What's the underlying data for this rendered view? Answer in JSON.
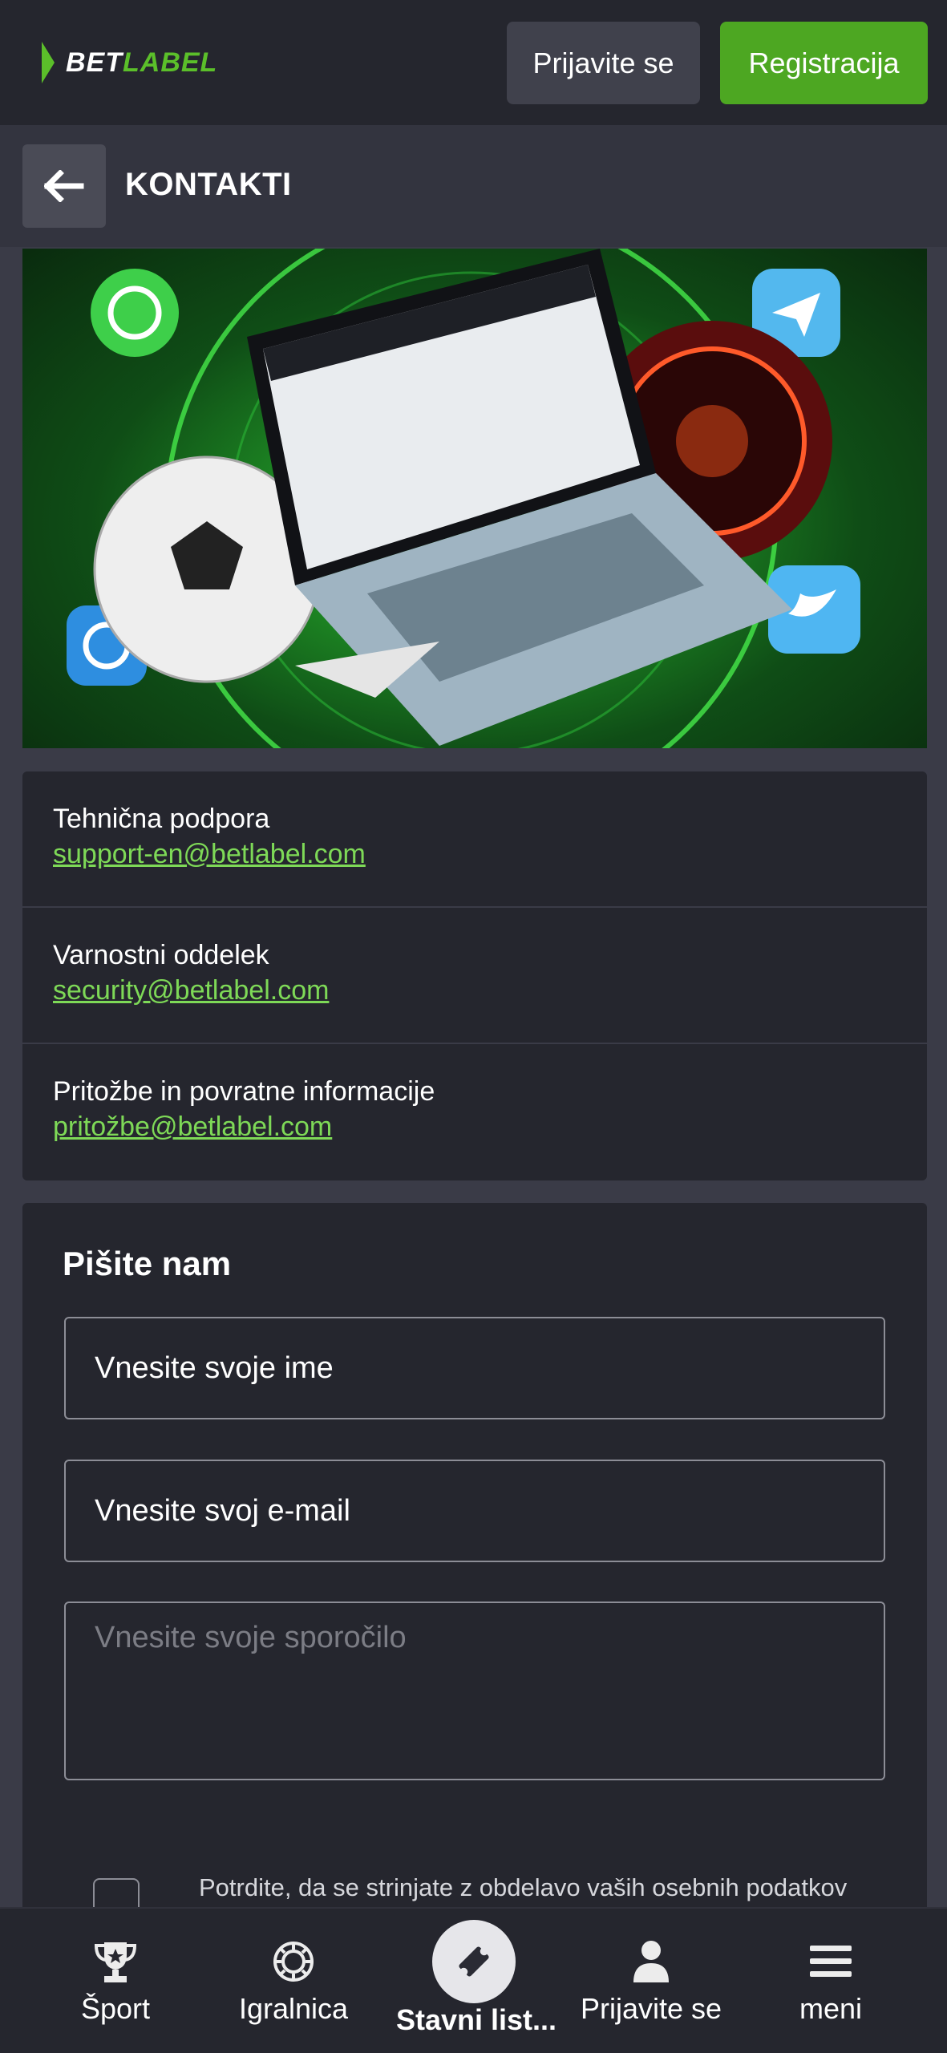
{
  "header": {
    "logo": {
      "part1": "BET",
      "part2": "LABEL"
    },
    "login_label": "Prijavite se",
    "register_label": "Registracija"
  },
  "titlebar": {
    "title": "KONTAKTI"
  },
  "colors": {
    "accent": "#4da722",
    "link": "#7ed957",
    "background": "#3a3b47",
    "panel": "#25262e"
  },
  "contacts": [
    {
      "label": "Tehnična podpora",
      "email": "support-en@betlabel.com"
    },
    {
      "label": "Varnostni oddelek",
      "email": "security@betlabel.com"
    },
    {
      "label": "Pritožbe in povratne informacije",
      "email": "pritožbe@betlabel.com"
    }
  ],
  "form": {
    "title": "Pišite nam",
    "name_placeholder": "Vnesite svoje ime",
    "email_placeholder": "Vnesite svoj e-mail",
    "message_placeholder": "Vnesite svoje sporočilo",
    "consent_text": "Potrdite, da se strinjate z obdelavo vaših osebnih podatkov"
  },
  "bottom_nav": [
    {
      "label": "Šport",
      "icon": "trophy-icon"
    },
    {
      "label": "Igralnica",
      "icon": "casino-chip-icon"
    },
    {
      "label": "Stavni list...",
      "icon": "ticket-icon"
    },
    {
      "label": "Prijavite se",
      "icon": "user-icon"
    },
    {
      "label": "meni",
      "icon": "menu-icon"
    }
  ]
}
